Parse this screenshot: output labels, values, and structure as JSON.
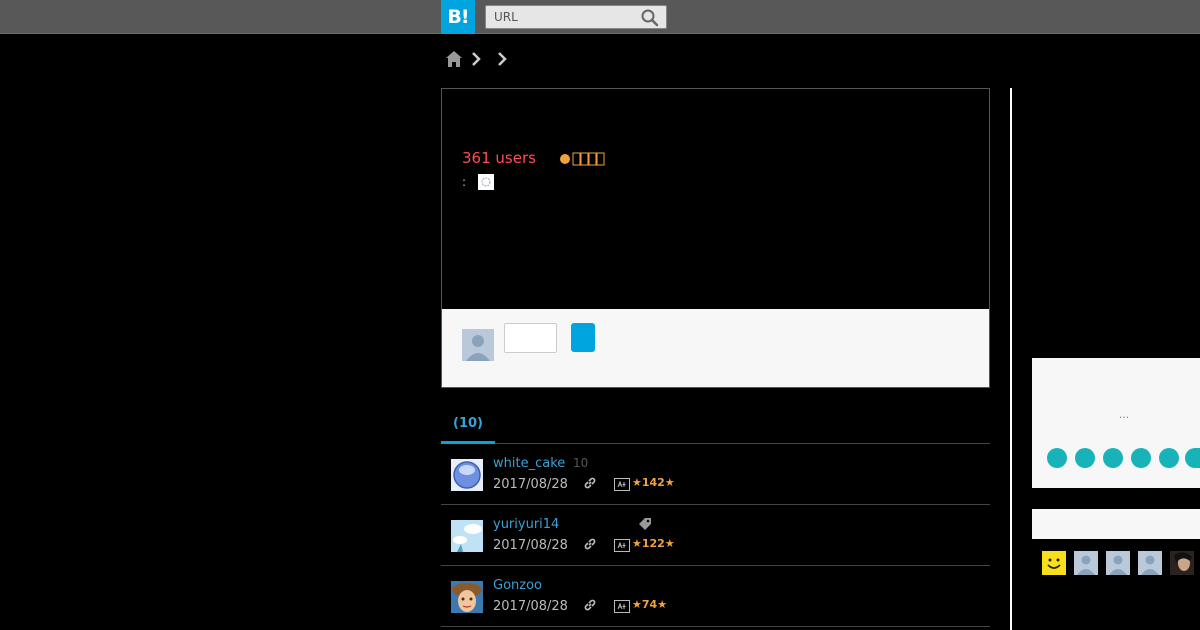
{
  "header": {
    "logo_text": "B!",
    "search_placeholder": "URL"
  },
  "entry": {
    "users_text": "361 users",
    "source_prefix": ":"
  },
  "tabs": [
    {
      "label": "(10)",
      "active": true
    }
  ],
  "bookmarks": [
    {
      "user": "white_cake",
      "count": "10",
      "date": "2017/08/28",
      "stars": "142"
    },
    {
      "user": "yuriyuri14",
      "date": "2017/08/28",
      "stars": "122",
      "has_tag": true
    },
    {
      "user": "Gonzoo",
      "date": "2017/08/28",
      "stars": "74"
    }
  ],
  "sidebar": {
    "ellipsis": "...",
    "dot_color": "#17b3b9"
  },
  "colors": {
    "accent": "#00a4de",
    "users_count": "#ff4d4d",
    "star": "#f1a23b",
    "link": "#39a1d8"
  }
}
